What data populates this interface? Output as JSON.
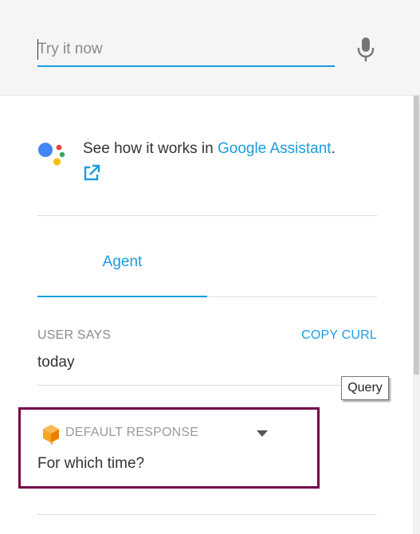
{
  "search": {
    "placeholder": "Try it now"
  },
  "assistant": {
    "text": "See how it works in ",
    "link_label": "Google Assistant",
    "suffix": "."
  },
  "tabs": [
    {
      "label": "Agent",
      "active": true
    }
  ],
  "user_says": {
    "label": "USER SAYS",
    "copy_curl_label": "COPY CURL",
    "query": "today"
  },
  "tooltip": {
    "text": "Query"
  },
  "default_response": {
    "label": "DEFAULT RESPONSE",
    "text": "For which time?"
  },
  "colors": {
    "accent": "#1a9ce0",
    "highlight_border": "#73004a",
    "top_bar_bg": "#f5f5f5"
  }
}
